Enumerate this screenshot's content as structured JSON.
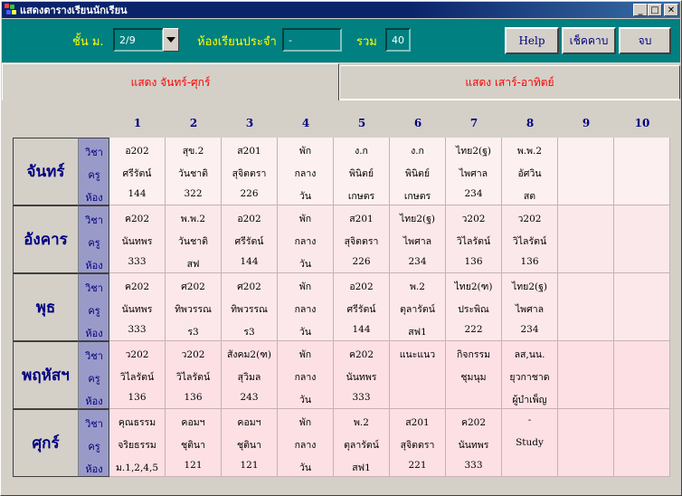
{
  "window": {
    "title": "แสดงตารางเรียนนักเรียน",
    "minimize_label": "_",
    "maximize_label": "□",
    "close_label": "✕"
  },
  "header": {
    "grade_label": "ชั้น ม.",
    "grade_value": "2/9",
    "homeroom_label": "ห้องเรียนประจำ",
    "homeroom_value": "-",
    "total_label": "รวม",
    "total_value": "40",
    "help_label": "Help",
    "check_period_label": "เช็คคาบ",
    "exit_label": "จบ"
  },
  "tabs": [
    {
      "label": "แสดง จันทร์-ศุกร์",
      "active": true
    },
    {
      "label": "แสดง เสาร์-อาทิตย์",
      "active": false
    }
  ],
  "periods": [
    "1",
    "2",
    "3",
    "4",
    "5",
    "6",
    "7",
    "8",
    "9",
    "10"
  ],
  "row_labels": {
    "subject": "วิชา",
    "teacher": "ครู",
    "room": "ห้อง"
  },
  "days": [
    {
      "name": "จันทร์",
      "cells": [
        [
          "อ202",
          "ศรีรัตน์",
          "144"
        ],
        [
          "สุข.2",
          "วันชาติ",
          "322"
        ],
        [
          "ส201",
          "สุจิตตรา",
          "226"
        ],
        [
          "พัก",
          "กลาง",
          "วัน"
        ],
        [
          "ง.ก",
          "พินิตย์",
          "เกษตร"
        ],
        [
          "ง.ก",
          "พินิตย์",
          "เกษตร"
        ],
        [
          "ไทย2(ฐ)",
          "ไพศาล",
          "234"
        ],
        [
          "พ.พ.2",
          "อัศวิน",
          "สต"
        ],
        [
          "",
          "",
          ""
        ],
        [
          "",
          "",
          ""
        ]
      ]
    },
    {
      "name": "อังคาร",
      "cells": [
        [
          "ค202",
          "นันทพร",
          "333"
        ],
        [
          "พ.พ.2",
          "วันชาติ",
          "สฟ"
        ],
        [
          "อ202",
          "ศรีรัตน์",
          "144"
        ],
        [
          "พัก",
          "กลาง",
          "วัน"
        ],
        [
          "ส201",
          "สุจิตตรา",
          "226"
        ],
        [
          "ไทย2(ฐ)",
          "ไพศาล",
          "234"
        ],
        [
          "ว202",
          "วิไลรัตน์",
          "136"
        ],
        [
          "ว202",
          "วิไลรัตน์",
          "136"
        ],
        [
          "",
          "",
          ""
        ],
        [
          "",
          "",
          ""
        ]
      ]
    },
    {
      "name": "พุธ",
      "cells": [
        [
          "ค202",
          "นันทพร",
          "333"
        ],
        [
          "ศ202",
          "ทิพวรรณ",
          "ร3"
        ],
        [
          "ศ202",
          "ทิพวรรณ",
          "ร3"
        ],
        [
          "พัก",
          "กลาง",
          "วัน"
        ],
        [
          "อ202",
          "ศรีรัตน์",
          "144"
        ],
        [
          "พ.2",
          "ตุลารัตน์",
          "สฟ1"
        ],
        [
          "ไทย2(ฑ)",
          "ประพิณ",
          "222"
        ],
        [
          "ไทย2(ฐ)",
          "ไพศาล",
          "234"
        ],
        [
          "",
          "",
          ""
        ],
        [
          "",
          "",
          ""
        ]
      ]
    },
    {
      "name": "พฤหัสฯ",
      "cells": [
        [
          "ว202",
          "วิไลรัตน์",
          "136"
        ],
        [
          "ว202",
          "วิไลรัตน์",
          "136"
        ],
        [
          "สังคม2(ฑ)",
          "สุวิมล",
          "243"
        ],
        [
          "พัก",
          "กลาง",
          "วัน"
        ],
        [
          "ค202",
          "นันทพร",
          "333"
        ],
        [
          "แนะแนว",
          "",
          ""
        ],
        [
          "กิจกรรม",
          "ชุมนุม",
          ""
        ],
        [
          "ลส,นน.",
          "ยุวกาชาด",
          "ผู้บำเพ็ญ"
        ],
        [
          "",
          "",
          ""
        ],
        [
          "",
          "",
          ""
        ]
      ]
    },
    {
      "name": "ศุกร์",
      "cells": [
        [
          "คุณธรรม",
          "จริยธรรม",
          "ม.1,2,4,5"
        ],
        [
          "คอมฯ",
          "ชุตินา",
          "121"
        ],
        [
          "คอมฯ",
          "ชุตินา",
          "121"
        ],
        [
          "พัก",
          "กลาง",
          "วัน"
        ],
        [
          "พ.2",
          "ตุลารัตน์",
          "สฟ1"
        ],
        [
          "ส201",
          "สุจิตตรา",
          "221"
        ],
        [
          "ค202",
          "นันทพร",
          "333"
        ],
        [
          "-",
          "Study",
          ""
        ],
        [
          "",
          "",
          ""
        ],
        [
          "",
          "",
          ""
        ]
      ]
    }
  ],
  "colors": {
    "row_tints": [
      "#fdf0f0",
      "#fbe8ea",
      "#fce8ea",
      "#fde0e4",
      "#fce0e3"
    ],
    "accent_navy": "#000080",
    "label_col": "#9a9ac8",
    "window_bg": "#d4d0c8",
    "header_bg": "#008080"
  }
}
